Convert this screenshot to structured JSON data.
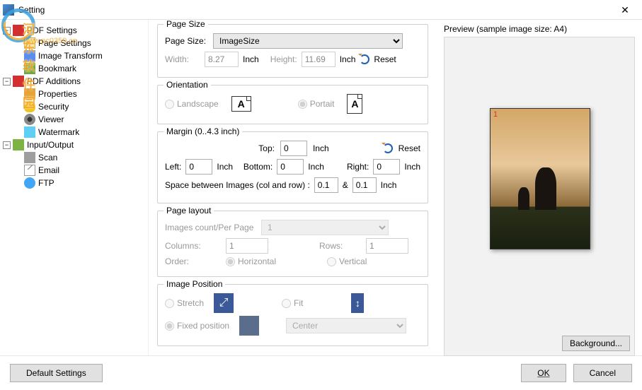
{
  "window": {
    "title": "Setting"
  },
  "watermark_text": "河东软件园",
  "watermark_sub": "www.pc0359.cn",
  "tree": {
    "pdf_settings": "PDF Settings",
    "page_settings": "Page Settings",
    "image_transform": "Image Transform",
    "bookmark": "Bookmark",
    "pdf_additions": "PDF Additions",
    "properties": "Properties",
    "security": "Security",
    "viewer": "Viewer",
    "watermark": "Watermark",
    "input_output": "Input/Output",
    "scan": "Scan",
    "email": "Email",
    "ftp": "FTP"
  },
  "page_size": {
    "legend": "Page Size",
    "label": "Page Size:",
    "value": "ImageSize",
    "width_label": "Width:",
    "width_value": "8.27",
    "height_label": "Height:",
    "height_value": "11.69",
    "unit": "Inch",
    "reset": "Reset"
  },
  "orientation": {
    "legend": "Orientation",
    "landscape": "Landscape",
    "portrait": "Portait",
    "a": "A"
  },
  "margin": {
    "legend": "Margin (0..4.3 inch)",
    "top": "Top:",
    "top_v": "0",
    "bottom": "Bottom:",
    "bottom_v": "0",
    "left": "Left:",
    "left_v": "0",
    "right": "Right:",
    "right_v": "0",
    "unit": "Inch",
    "reset": "Reset",
    "space_label": "Space between Images (col and row) :",
    "space_col": "0.1",
    "space_amp": "&",
    "space_row": "0.1"
  },
  "layout": {
    "legend": "Page layout",
    "count_label": "Images count/Per Page",
    "count_value": "1",
    "cols_label": "Columns:",
    "cols_value": "1",
    "rows_label": "Rows:",
    "rows_value": "1",
    "order_label": "Order:",
    "horizontal": "Horizontal",
    "vertical": "Vertical"
  },
  "position": {
    "legend": "Image Position",
    "stretch": "Stretch",
    "fit": "Fit",
    "fixed": "Fixed position",
    "align_value": "Center"
  },
  "preview": {
    "label": "Preview (sample image size: A4)",
    "page_num": "1",
    "bg_button": "Background..."
  },
  "footer": {
    "default": "Default Settings",
    "ok": "OK",
    "cancel": "Cancel"
  }
}
